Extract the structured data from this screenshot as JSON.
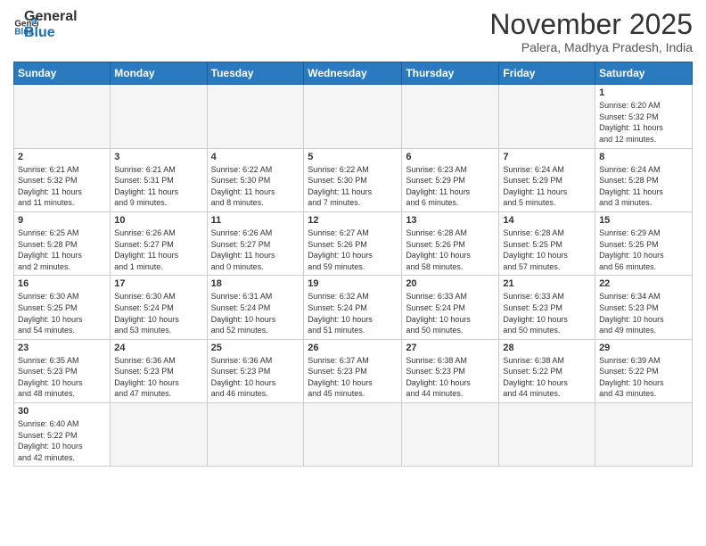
{
  "header": {
    "logo_general": "General",
    "logo_blue": "Blue",
    "month_title": "November 2025",
    "subtitle": "Palera, Madhya Pradesh, India"
  },
  "weekdays": [
    "Sunday",
    "Monday",
    "Tuesday",
    "Wednesday",
    "Thursday",
    "Friday",
    "Saturday"
  ],
  "weeks": [
    [
      {
        "day": "",
        "info": ""
      },
      {
        "day": "",
        "info": ""
      },
      {
        "day": "",
        "info": ""
      },
      {
        "day": "",
        "info": ""
      },
      {
        "day": "",
        "info": ""
      },
      {
        "day": "",
        "info": ""
      },
      {
        "day": "1",
        "info": "Sunrise: 6:20 AM\nSunset: 5:32 PM\nDaylight: 11 hours\nand 12 minutes."
      }
    ],
    [
      {
        "day": "2",
        "info": "Sunrise: 6:21 AM\nSunset: 5:32 PM\nDaylight: 11 hours\nand 11 minutes."
      },
      {
        "day": "3",
        "info": "Sunrise: 6:21 AM\nSunset: 5:31 PM\nDaylight: 11 hours\nand 9 minutes."
      },
      {
        "day": "4",
        "info": "Sunrise: 6:22 AM\nSunset: 5:30 PM\nDaylight: 11 hours\nand 8 minutes."
      },
      {
        "day": "5",
        "info": "Sunrise: 6:22 AM\nSunset: 5:30 PM\nDaylight: 11 hours\nand 7 minutes."
      },
      {
        "day": "6",
        "info": "Sunrise: 6:23 AM\nSunset: 5:29 PM\nDaylight: 11 hours\nand 6 minutes."
      },
      {
        "day": "7",
        "info": "Sunrise: 6:24 AM\nSunset: 5:29 PM\nDaylight: 11 hours\nand 5 minutes."
      },
      {
        "day": "8",
        "info": "Sunrise: 6:24 AM\nSunset: 5:28 PM\nDaylight: 11 hours\nand 3 minutes."
      }
    ],
    [
      {
        "day": "9",
        "info": "Sunrise: 6:25 AM\nSunset: 5:28 PM\nDaylight: 11 hours\nand 2 minutes."
      },
      {
        "day": "10",
        "info": "Sunrise: 6:26 AM\nSunset: 5:27 PM\nDaylight: 11 hours\nand 1 minute."
      },
      {
        "day": "11",
        "info": "Sunrise: 6:26 AM\nSunset: 5:27 PM\nDaylight: 11 hours\nand 0 minutes."
      },
      {
        "day": "12",
        "info": "Sunrise: 6:27 AM\nSunset: 5:26 PM\nDaylight: 10 hours\nand 59 minutes."
      },
      {
        "day": "13",
        "info": "Sunrise: 6:28 AM\nSunset: 5:26 PM\nDaylight: 10 hours\nand 58 minutes."
      },
      {
        "day": "14",
        "info": "Sunrise: 6:28 AM\nSunset: 5:25 PM\nDaylight: 10 hours\nand 57 minutes."
      },
      {
        "day": "15",
        "info": "Sunrise: 6:29 AM\nSunset: 5:25 PM\nDaylight: 10 hours\nand 56 minutes."
      }
    ],
    [
      {
        "day": "16",
        "info": "Sunrise: 6:30 AM\nSunset: 5:25 PM\nDaylight: 10 hours\nand 54 minutes."
      },
      {
        "day": "17",
        "info": "Sunrise: 6:30 AM\nSunset: 5:24 PM\nDaylight: 10 hours\nand 53 minutes."
      },
      {
        "day": "18",
        "info": "Sunrise: 6:31 AM\nSunset: 5:24 PM\nDaylight: 10 hours\nand 52 minutes."
      },
      {
        "day": "19",
        "info": "Sunrise: 6:32 AM\nSunset: 5:24 PM\nDaylight: 10 hours\nand 51 minutes."
      },
      {
        "day": "20",
        "info": "Sunrise: 6:33 AM\nSunset: 5:24 PM\nDaylight: 10 hours\nand 50 minutes."
      },
      {
        "day": "21",
        "info": "Sunrise: 6:33 AM\nSunset: 5:23 PM\nDaylight: 10 hours\nand 50 minutes."
      },
      {
        "day": "22",
        "info": "Sunrise: 6:34 AM\nSunset: 5:23 PM\nDaylight: 10 hours\nand 49 minutes."
      }
    ],
    [
      {
        "day": "23",
        "info": "Sunrise: 6:35 AM\nSunset: 5:23 PM\nDaylight: 10 hours\nand 48 minutes."
      },
      {
        "day": "24",
        "info": "Sunrise: 6:36 AM\nSunset: 5:23 PM\nDaylight: 10 hours\nand 47 minutes."
      },
      {
        "day": "25",
        "info": "Sunrise: 6:36 AM\nSunset: 5:23 PM\nDaylight: 10 hours\nand 46 minutes."
      },
      {
        "day": "26",
        "info": "Sunrise: 6:37 AM\nSunset: 5:23 PM\nDaylight: 10 hours\nand 45 minutes."
      },
      {
        "day": "27",
        "info": "Sunrise: 6:38 AM\nSunset: 5:23 PM\nDaylight: 10 hours\nand 44 minutes."
      },
      {
        "day": "28",
        "info": "Sunrise: 6:38 AM\nSunset: 5:22 PM\nDaylight: 10 hours\nand 44 minutes."
      },
      {
        "day": "29",
        "info": "Sunrise: 6:39 AM\nSunset: 5:22 PM\nDaylight: 10 hours\nand 43 minutes."
      }
    ],
    [
      {
        "day": "30",
        "info": "Sunrise: 6:40 AM\nSunset: 5:22 PM\nDaylight: 10 hours\nand 42 minutes."
      },
      {
        "day": "",
        "info": ""
      },
      {
        "day": "",
        "info": ""
      },
      {
        "day": "",
        "info": ""
      },
      {
        "day": "",
        "info": ""
      },
      {
        "day": "",
        "info": ""
      },
      {
        "day": "",
        "info": ""
      }
    ]
  ]
}
